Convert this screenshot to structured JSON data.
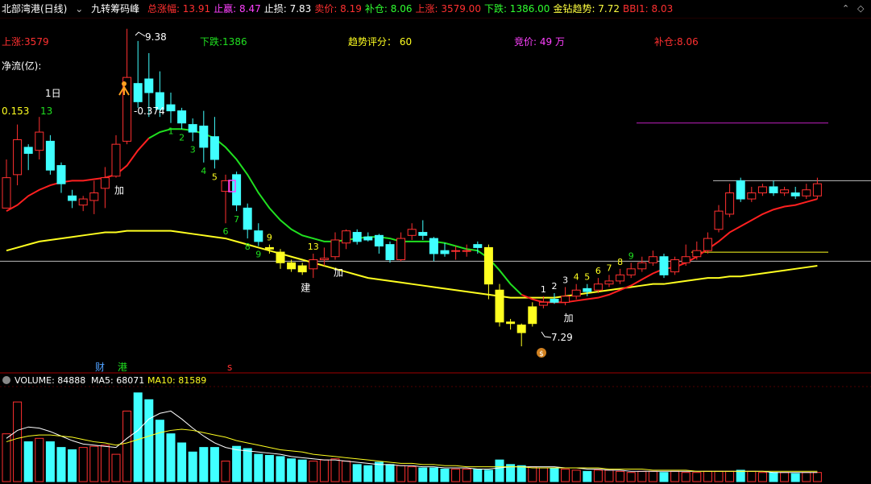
{
  "header": {
    "title": "北部湾港(日线)",
    "indicator_name": "九转筹码峰",
    "items": [
      {
        "label": "总涨幅:",
        "value": "13.91",
        "color": "#ff3030"
      },
      {
        "label": "止赢:",
        "value": "8.47",
        "color": "#ff40ff"
      },
      {
        "label": "止损:",
        "value": "7.83",
        "color": "#ffffff"
      },
      {
        "label": "卖价:",
        "value": "8.19",
        "color": "#ff3030"
      },
      {
        "label": "补仓:",
        "value": "8.06",
        "color": "#30ff30"
      },
      {
        "label": "上涨:",
        "value": "3579.00",
        "color": "#ff3030"
      },
      {
        "label": "下跌:",
        "value": "1386.00",
        "color": "#30ff30"
      },
      {
        "label": "金钻趋势:",
        "value": "7.72",
        "color": "#ffff40"
      },
      {
        "label": "BBI1:",
        "value": "8.03",
        "color": "#ff3030"
      }
    ]
  },
  "info_row": {
    "up": "上涨:3579",
    "down": "下跌:1386",
    "score": "趋势评分： 60",
    "bid": "竞价: 49 万",
    "add": "补仓:8.06"
  },
  "labels": {
    "net_flow": "净流(亿):",
    "one_day": "1日",
    "flow_value": "0.153",
    "flow_count": "13",
    "high_mark": "9.38",
    "low_mark": "7.29",
    "neg_value": "-0.374",
    "cai": "财",
    "gang": "港",
    "s": "s"
  },
  "volume_header": {
    "vol_label": "VOLUME: 84888",
    "ma5_label": "MA5: 68071",
    "ma10_label": "MA10: 81589"
  },
  "colors": {
    "up": "#ff3030",
    "down": "#40ffff",
    "ma_red": "#ff2020",
    "ma_green": "#20e020",
    "ma_yellow": "#ffff20",
    "grid": "#800000"
  },
  "chart_data": {
    "type": "candlestick",
    "ylim": [
      7.2,
      9.4
    ],
    "candles": [
      {
        "o": 8.2,
        "c": 8.4,
        "h": 8.52,
        "l": 8.2,
        "u": true
      },
      {
        "o": 8.42,
        "c": 8.65,
        "h": 8.75,
        "l": 8.35,
        "u": true
      },
      {
        "o": 8.6,
        "c": 8.56,
        "h": 8.62,
        "l": 8.45,
        "u": false
      },
      {
        "o": 8.58,
        "c": 8.7,
        "h": 8.8,
        "l": 8.52,
        "u": true
      },
      {
        "o": 8.64,
        "c": 8.45,
        "h": 8.68,
        "l": 8.42,
        "u": false
      },
      {
        "o": 8.48,
        "c": 8.36,
        "h": 8.5,
        "l": 8.3,
        "u": false
      },
      {
        "o": 8.28,
        "c": 8.25,
        "h": 8.32,
        "l": 8.2,
        "u": false
      },
      {
        "o": 8.26,
        "c": 8.22,
        "h": 8.28,
        "l": 8.18,
        "u": true
      },
      {
        "o": 8.25,
        "c": 8.3,
        "h": 8.38,
        "l": 8.16,
        "u": true
      },
      {
        "o": 8.33,
        "c": 8.4,
        "h": 8.47,
        "l": 8.2,
        "u": true
      },
      {
        "o": 8.41,
        "c": 8.62,
        "h": 8.68,
        "l": 8.4,
        "u": true
      },
      {
        "o": 8.64,
        "c": 9.06,
        "h": 9.38,
        "l": 8.62,
        "u": true
      },
      {
        "o": 9.02,
        "c": 8.9,
        "h": 9.3,
        "l": 8.86,
        "u": false
      },
      {
        "o": 9.05,
        "c": 8.96,
        "h": 9.22,
        "l": 8.8,
        "u": false
      },
      {
        "o": 8.96,
        "c": 8.85,
        "h": 9.1,
        "l": 8.8,
        "u": false
      },
      {
        "o": 8.88,
        "c": 8.84,
        "h": 8.96,
        "l": 8.76,
        "u": false
      },
      {
        "o": 8.84,
        "c": 8.76,
        "h": 8.86,
        "l": 8.72,
        "u": false
      },
      {
        "o": 8.75,
        "c": 8.7,
        "h": 8.79,
        "l": 8.64,
        "u": false
      },
      {
        "o": 8.74,
        "c": 8.6,
        "h": 8.84,
        "l": 8.5,
        "u": false
      },
      {
        "o": 8.67,
        "c": 8.52,
        "h": 8.8,
        "l": 8.46,
        "u": false
      },
      {
        "o": 8.31,
        "c": 8.38,
        "h": 8.42,
        "l": 8.1,
        "u": true
      },
      {
        "o": 8.42,
        "c": 8.22,
        "h": 8.44,
        "l": 8.18,
        "u": false
      },
      {
        "o": 8.2,
        "c": 8.06,
        "h": 8.23,
        "l": 8.0,
        "u": false
      },
      {
        "o": 8.05,
        "c": 7.98,
        "h": 8.1,
        "l": 7.95,
        "u": false
      },
      {
        "o": 7.94,
        "c": 7.93,
        "h": 7.96,
        "l": 7.9,
        "u": false
      },
      {
        "o": 7.91,
        "c": 7.84,
        "h": 7.93,
        "l": 7.8,
        "u": false
      },
      {
        "o": 7.84,
        "c": 7.8,
        "h": 7.86,
        "l": 7.78,
        "u": false
      },
      {
        "o": 7.82,
        "c": 7.78,
        "h": 7.84,
        "l": 7.76,
        "u": false
      },
      {
        "o": 7.8,
        "c": 7.86,
        "h": 7.9,
        "l": 7.74,
        "u": true
      },
      {
        "o": 7.86,
        "c": 7.87,
        "h": 7.94,
        "l": 7.82,
        "u": true
      },
      {
        "o": 7.88,
        "c": 7.99,
        "h": 8.04,
        "l": 7.86,
        "u": true
      },
      {
        "o": 7.97,
        "c": 8.05,
        "h": 8.06,
        "l": 7.93,
        "u": true
      },
      {
        "o": 8.04,
        "c": 7.98,
        "h": 8.06,
        "l": 7.96,
        "u": false
      },
      {
        "o": 8.01,
        "c": 7.99,
        "h": 8.04,
        "l": 7.98,
        "u": false
      },
      {
        "o": 8.02,
        "c": 7.95,
        "h": 8.03,
        "l": 7.9,
        "u": false
      },
      {
        "o": 7.96,
        "c": 7.86,
        "h": 7.98,
        "l": 7.84,
        "u": false
      },
      {
        "o": 7.86,
        "c": 8.0,
        "h": 8.04,
        "l": 7.85,
        "u": true
      },
      {
        "o": 8.02,
        "c": 8.06,
        "h": 8.1,
        "l": 7.99,
        "u": true
      },
      {
        "o": 8.04,
        "c": 8.02,
        "h": 8.12,
        "l": 7.99,
        "u": false
      },
      {
        "o": 8.0,
        "c": 7.9,
        "h": 8.01,
        "l": 7.85,
        "u": false
      },
      {
        "o": 7.92,
        "c": 7.9,
        "h": 7.97,
        "l": 7.88,
        "u": false
      },
      {
        "o": 7.92,
        "c": 7.92,
        "h": 7.95,
        "l": 7.86,
        "u": true
      },
      {
        "o": 7.92,
        "c": 7.92,
        "h": 7.96,
        "l": 7.88,
        "u": true
      },
      {
        "o": 7.96,
        "c": 7.94,
        "h": 7.98,
        "l": 7.9,
        "u": false
      },
      {
        "o": 7.94,
        "c": 7.7,
        "h": 7.96,
        "l": 7.6,
        "u": false
      },
      {
        "o": 7.66,
        "c": 7.45,
        "h": 7.7,
        "l": 7.42,
        "u": false
      },
      {
        "o": 7.45,
        "c": 7.44,
        "h": 7.47,
        "l": 7.4,
        "u": false
      },
      {
        "o": 7.43,
        "c": 7.38,
        "h": 7.44,
        "l": 7.29,
        "u": false
      },
      {
        "o": 7.44,
        "c": 7.55,
        "h": 7.58,
        "l": 7.42,
        "u": true
      },
      {
        "o": 7.56,
        "c": 7.58,
        "h": 7.62,
        "l": 7.54,
        "u": true
      },
      {
        "o": 7.58,
        "c": 7.6,
        "h": 7.64,
        "l": 7.57,
        "u": false
      },
      {
        "o": 7.58,
        "c": 7.62,
        "h": 7.68,
        "l": 7.56,
        "u": true
      },
      {
        "o": 7.62,
        "c": 7.66,
        "h": 7.7,
        "l": 7.6,
        "u": true
      },
      {
        "o": 7.65,
        "c": 7.67,
        "h": 7.7,
        "l": 7.62,
        "u": false
      },
      {
        "o": 7.66,
        "c": 7.7,
        "h": 7.74,
        "l": 7.64,
        "u": true
      },
      {
        "o": 7.7,
        "c": 7.72,
        "h": 7.76,
        "l": 7.68,
        "u": true
      },
      {
        "o": 7.72,
        "c": 7.76,
        "h": 7.8,
        "l": 7.7,
        "u": true
      },
      {
        "o": 7.76,
        "c": 7.8,
        "h": 7.84,
        "l": 7.74,
        "u": true
      },
      {
        "o": 7.8,
        "c": 7.84,
        "h": 7.88,
        "l": 7.78,
        "u": true
      },
      {
        "o": 7.84,
        "c": 7.88,
        "h": 7.92,
        "l": 7.82,
        "u": true
      },
      {
        "o": 7.88,
        "c": 7.76,
        "h": 7.9,
        "l": 7.74,
        "u": false
      },
      {
        "o": 7.78,
        "c": 7.86,
        "h": 7.88,
        "l": 7.76,
        "u": true
      },
      {
        "o": 7.84,
        "c": 7.88,
        "h": 7.96,
        "l": 7.82,
        "u": true
      },
      {
        "o": 7.88,
        "c": 7.92,
        "h": 7.98,
        "l": 7.86,
        "u": true
      },
      {
        "o": 7.92,
        "c": 8.0,
        "h": 8.04,
        "l": 7.9,
        "u": true
      },
      {
        "o": 8.06,
        "c": 8.18,
        "h": 8.22,
        "l": 8.04,
        "u": true
      },
      {
        "o": 8.16,
        "c": 8.3,
        "h": 8.36,
        "l": 8.14,
        "u": true
      },
      {
        "o": 8.38,
        "c": 8.26,
        "h": 8.4,
        "l": 8.24,
        "u": false
      },
      {
        "o": 8.26,
        "c": 8.3,
        "h": 8.34,
        "l": 8.24,
        "u": true
      },
      {
        "o": 8.3,
        "c": 8.34,
        "h": 8.36,
        "l": 8.28,
        "u": true
      },
      {
        "o": 8.34,
        "c": 8.3,
        "h": 8.38,
        "l": 8.28,
        "u": false
      },
      {
        "o": 8.3,
        "c": 8.32,
        "h": 8.34,
        "l": 8.28,
        "u": true
      },
      {
        "o": 8.3,
        "c": 8.28,
        "h": 8.34,
        "l": 8.26,
        "u": false
      },
      {
        "o": 8.28,
        "c": 8.32,
        "h": 8.36,
        "l": 8.26,
        "u": true
      },
      {
        "o": 8.28,
        "c": 8.36,
        "h": 8.4,
        "l": 8.26,
        "u": true
      }
    ],
    "ma_fast": [
      8.18,
      8.22,
      8.28,
      8.32,
      8.35,
      8.37,
      8.38,
      8.38,
      8.39,
      8.4,
      8.42,
      8.48,
      8.58,
      8.66,
      8.7,
      8.72,
      8.72,
      8.71,
      8.69,
      8.66,
      8.6,
      8.52,
      8.42,
      8.3,
      8.2,
      8.12,
      8.06,
      8.02,
      8.0,
      7.98,
      7.98,
      7.99,
      8.0,
      8.01,
      8.01,
      8.0,
      7.98,
      7.98,
      7.98,
      7.98,
      7.97,
      7.95,
      7.93,
      7.92,
      7.87,
      7.79,
      7.7,
      7.63,
      7.6,
      7.58,
      7.58,
      7.58,
      7.59,
      7.6,
      7.61,
      7.63,
      7.66,
      7.69,
      7.73,
      7.77,
      7.8,
      7.81,
      7.84,
      7.88,
      7.93,
      7.98,
      8.04,
      8.08,
      8.12,
      8.16,
      8.19,
      8.21,
      8.22,
      8.24,
      8.26
    ],
    "ma_fast_green_from": 13,
    "ma_fast_green_to": 47,
    "ma_slow": [
      7.92,
      7.94,
      7.96,
      7.98,
      7.99,
      8.0,
      8.01,
      8.02,
      8.03,
      8.04,
      8.04,
      8.05,
      8.05,
      8.05,
      8.05,
      8.05,
      8.04,
      8.03,
      8.02,
      8.01,
      8.0,
      7.98,
      7.96,
      7.94,
      7.92,
      7.9,
      7.88,
      7.86,
      7.84,
      7.82,
      7.8,
      7.78,
      7.76,
      7.74,
      7.73,
      7.72,
      7.71,
      7.7,
      7.69,
      7.68,
      7.67,
      7.66,
      7.65,
      7.64,
      7.63,
      7.62,
      7.61,
      7.61,
      7.61,
      7.61,
      7.61,
      7.62,
      7.63,
      7.64,
      7.65,
      7.66,
      7.67,
      7.68,
      7.69,
      7.7,
      7.7,
      7.71,
      7.72,
      7.73,
      7.74,
      7.74,
      7.75,
      7.75,
      7.76,
      7.77,
      7.78,
      7.79,
      7.8,
      7.81,
      7.82
    ],
    "volumes": [
      42,
      70,
      35,
      38,
      35,
      30,
      28,
      30,
      31,
      32,
      24,
      62,
      78,
      72,
      54,
      42,
      34,
      26,
      30,
      30,
      18,
      31,
      29,
      24,
      23,
      22,
      20,
      19,
      18,
      19,
      20,
      18,
      15,
      14,
      17,
      15,
      14,
      13,
      12,
      12,
      11,
      11,
      11,
      11,
      10,
      19,
      15,
      14,
      13,
      12,
      12,
      11,
      10,
      9,
      10,
      10,
      9,
      8,
      9,
      9,
      8,
      9,
      8,
      8,
      9,
      9,
      9,
      10,
      9,
      8,
      8,
      8,
      7,
      8,
      8
    ],
    "vol_ma5": [
      38,
      45,
      48,
      47,
      44,
      40,
      36,
      33,
      32,
      31,
      30,
      38,
      45,
      55,
      60,
      62,
      55,
      47,
      40,
      34,
      30,
      28,
      27,
      26,
      25,
      24,
      22,
      21,
      20,
      19,
      19,
      18,
      17,
      16,
      15,
      15,
      14,
      14,
      13,
      13,
      12,
      12,
      12,
      11,
      11,
      12,
      13,
      13,
      13,
      13,
      13,
      12,
      12,
      11,
      11,
      10,
      10,
      9,
      9,
      9,
      9,
      9,
      9,
      9,
      9,
      9,
      9,
      9,
      9,
      9,
      8,
      8,
      8,
      8,
      8
    ],
    "vol_ma10": [
      35,
      38,
      40,
      41,
      41,
      40,
      39,
      37,
      35,
      34,
      32,
      34,
      37,
      40,
      43,
      45,
      46,
      45,
      43,
      41,
      39,
      36,
      34,
      32,
      30,
      28,
      27,
      26,
      24,
      23,
      22,
      21,
      20,
      19,
      18,
      17,
      16,
      16,
      15,
      15,
      14,
      14,
      13,
      13,
      13,
      13,
      13,
      13,
      12,
      12,
      12,
      12,
      12,
      12,
      12,
      11,
      11,
      11,
      11,
      10,
      10,
      10,
      10,
      9,
      9,
      9,
      9,
      9,
      9,
      9,
      9,
      9,
      9,
      9,
      9
    ],
    "nine_labels": [
      {
        "i": 15,
        "t": "1",
        "c": "#20e020",
        "pos": "below"
      },
      {
        "i": 16,
        "t": "2",
        "c": "#20e020",
        "pos": "below"
      },
      {
        "i": 17,
        "t": "3",
        "c": "#20e020",
        "pos": "below"
      },
      {
        "i": 18,
        "t": "4",
        "c": "#20e020",
        "pos": "below"
      },
      {
        "i": 19,
        "t": "5",
        "c": "#ffff20",
        "pos": "below"
      },
      {
        "i": 20,
        "t": "6",
        "c": "#20e020",
        "pos": "below"
      },
      {
        "i": 21,
        "t": "7",
        "c": "#20e020",
        "pos": "below"
      },
      {
        "i": 22,
        "t": "8",
        "c": "#20e020",
        "pos": "below"
      },
      {
        "i": 23,
        "t": "9",
        "c": "#20e020",
        "pos": "below"
      },
      {
        "i": 24,
        "t": "9",
        "c": "#ffff20",
        "pos": "above"
      },
      {
        "i": 28,
        "t": "13",
        "c": "#ffff20",
        "pos": "above"
      },
      {
        "i": 49,
        "t": "1",
        "c": "#ffffff",
        "pos": "above"
      },
      {
        "i": 50,
        "t": "2",
        "c": "#ffffff",
        "pos": "above"
      },
      {
        "i": 51,
        "t": "3",
        "c": "#ffffff",
        "pos": "above"
      },
      {
        "i": 52,
        "t": "4",
        "c": "#ffff20",
        "pos": "above"
      },
      {
        "i": 53,
        "t": "5",
        "c": "#ffff20",
        "pos": "above"
      },
      {
        "i": 54,
        "t": "6",
        "c": "#ffff20",
        "pos": "above"
      },
      {
        "i": 55,
        "t": "7",
        "c": "#ffff20",
        "pos": "above"
      },
      {
        "i": 56,
        "t": "8",
        "c": "#ffff20",
        "pos": "above"
      },
      {
        "i": 57,
        "t": "9",
        "c": "#20e020",
        "pos": "above"
      }
    ],
    "marks": [
      {
        "i": 10,
        "t": "加",
        "c": "#ffffff",
        "pos": "below"
      },
      {
        "i": 27,
        "t": "建",
        "c": "#ffffff",
        "pos": "below"
      },
      {
        "i": 30,
        "t": "加",
        "c": "#ffffff",
        "pos": "below"
      },
      {
        "i": 51,
        "t": "加",
        "c": "#ffffff",
        "pos": "below"
      }
    ],
    "hlines": [
      {
        "price": 8.76,
        "x0": 790,
        "x1": 1028,
        "c": "#c020c0"
      },
      {
        "price": 8.38,
        "x0": 885,
        "x1": 1081,
        "c": "#bbbbbb"
      },
      {
        "price": 7.91,
        "x0": 858,
        "x1": 1028,
        "c": "#ffff20"
      },
      {
        "price": 7.85,
        "x0": 0,
        "x1": 1081,
        "c": "#bbbbbb"
      }
    ]
  }
}
